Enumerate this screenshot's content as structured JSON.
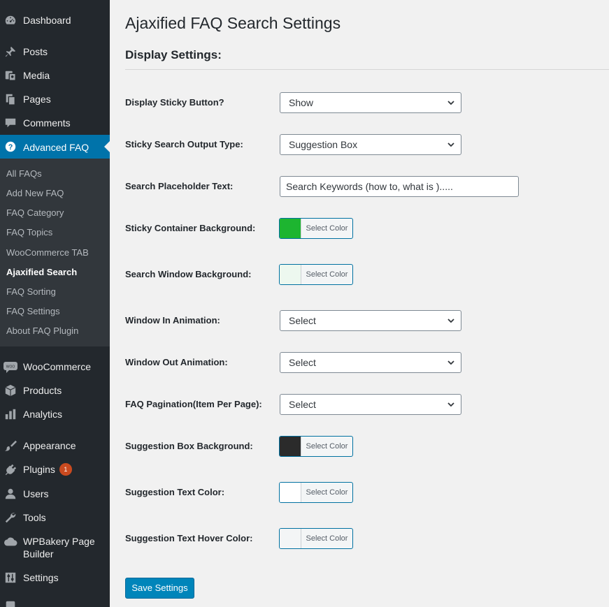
{
  "sidebar": {
    "dashboard": "Dashboard",
    "posts": "Posts",
    "media": "Media",
    "pages": "Pages",
    "comments": "Comments",
    "advanced_faq": "Advanced FAQ",
    "submenu": {
      "all_faqs": "All FAQs",
      "add_new_faq": "Add New FAQ",
      "faq_category": "FAQ Category",
      "faq_topics": "FAQ Topics",
      "woocommerce_tab": "WooCommerce TAB",
      "ajaxified_search": "Ajaxified Search",
      "faq_sorting": "FAQ Sorting",
      "faq_settings": "FAQ Settings",
      "about_faq_plugin": "About FAQ Plugin"
    },
    "woocommerce": "WooCommerce",
    "woo_icon_text": "WOO",
    "products": "Products",
    "analytics": "Analytics",
    "appearance": "Appearance",
    "plugins": "Plugins",
    "plugins_badge": "1",
    "users": "Users",
    "tools": "Tools",
    "wpbakery": "WPBakery Page Builder",
    "settings": "Settings"
  },
  "page": {
    "title": "Ajaxified FAQ Search Settings",
    "section_title": "Display Settings:"
  },
  "fields": {
    "sticky_button": {
      "label": "Display Sticky Button?",
      "value": "Show"
    },
    "output_type": {
      "label": "Sticky Search Output Type:",
      "value": "Suggestion Box"
    },
    "placeholder_text": {
      "label": "Search Placeholder Text:",
      "value": "Search Keywords (how to, what is )....."
    },
    "sticky_bg": {
      "label": "Sticky Container Background:",
      "button": "Select Color",
      "color": "#1db530"
    },
    "window_bg": {
      "label": "Search Window Background:",
      "button": "Select Color",
      "color": "#edf8ef"
    },
    "window_in": {
      "label": "Window In Animation:",
      "value": "Select"
    },
    "window_out": {
      "label": "Window Out Animation:",
      "value": "Select"
    },
    "pagination": {
      "label": "FAQ Pagination(Item Per Page):",
      "value": "Select"
    },
    "suggestion_bg": {
      "label": "Suggestion Box Background:",
      "button": "Select Color",
      "color": "#2b2b2b"
    },
    "suggestion_text": {
      "label": "Suggestion Text Color:",
      "button": "Select Color",
      "color": "#ffffff"
    },
    "suggestion_hover": {
      "label": "Suggestion Text Hover Color:",
      "button": "Select Color",
      "color": "#f3f5f6"
    }
  },
  "save_label": "Save Settings",
  "colors": {
    "sidebar_bg": "#23282d",
    "submenu_bg": "#32373c",
    "accent": "#0073aa",
    "badge": "#ca4a1f"
  }
}
